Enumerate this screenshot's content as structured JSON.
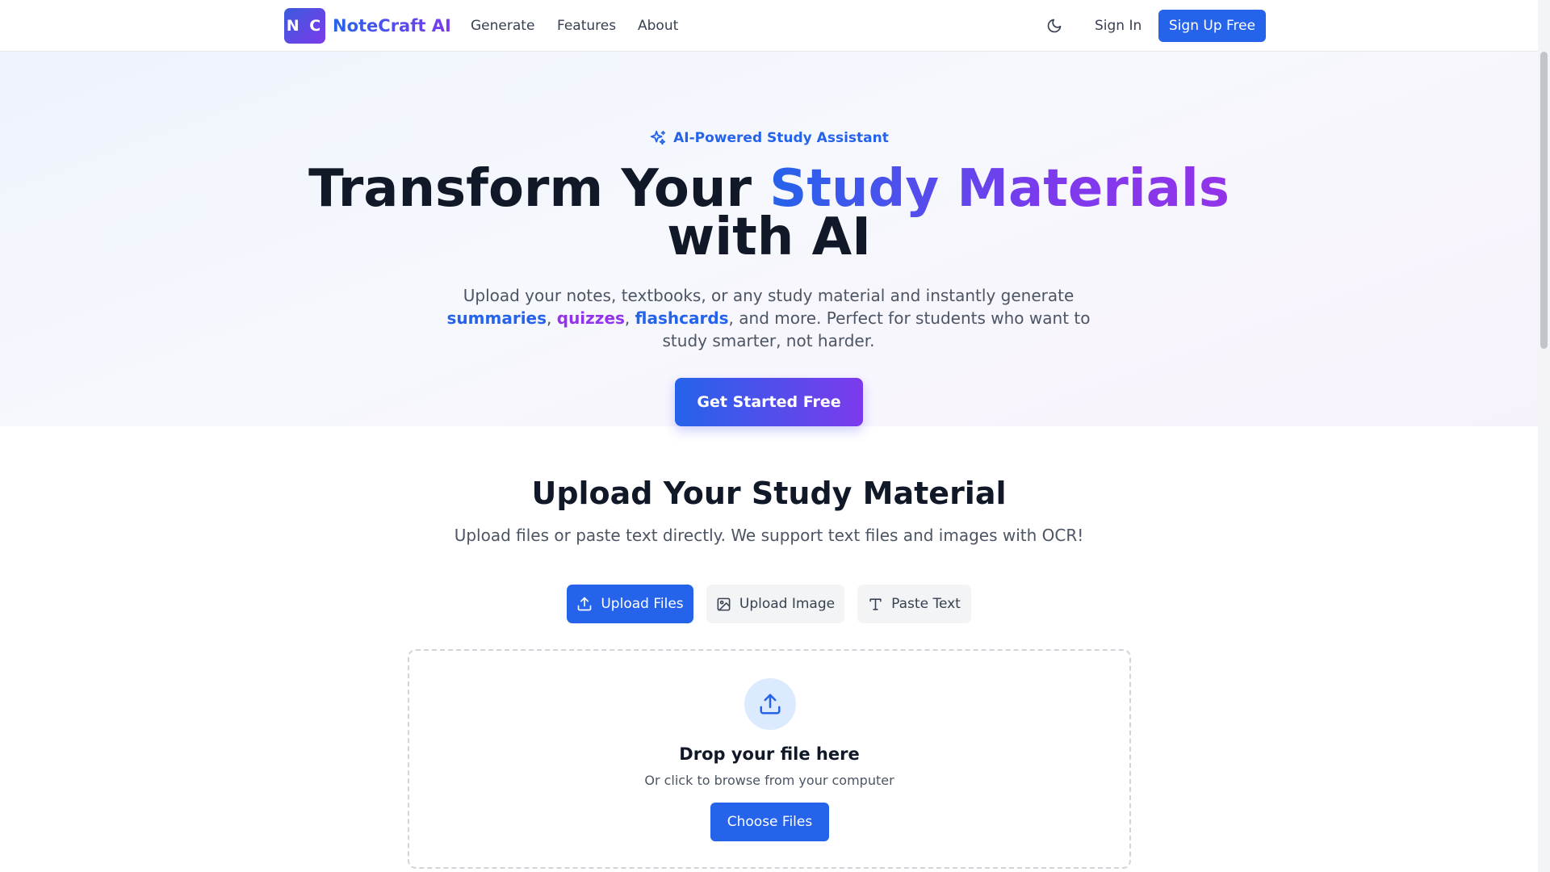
{
  "header": {
    "logo_initials": "N C",
    "brand": "NoteCraft AI",
    "nav": [
      "Generate",
      "Features",
      "About"
    ],
    "theme_icon": "moon-icon",
    "signin_label": "Sign In",
    "signup_label": "Sign Up Free"
  },
  "hero": {
    "badge_icon": "sparkles-icon",
    "badge": "AI-Powered Study Assistant",
    "title_part1": "Transform Your ",
    "title_highlight": "Study Materials",
    "title_part2": "with AI",
    "subtitle_part1": "Upload your notes, textbooks, or any study material and instantly generate ",
    "subtitle_summaries": "summaries",
    "subtitle_sep1": ", ",
    "subtitle_quizzes": "quizzes",
    "subtitle_sep2": ", ",
    "subtitle_flashcards": "flashcards",
    "subtitle_part2": ", and more. Perfect for students who want to study smarter, not harder.",
    "cta_label": "Get Started Free"
  },
  "upload": {
    "title": "Upload Your Study Material",
    "subtitle": "Upload files or paste text directly. We support text files and images with OCR!",
    "tabs": [
      {
        "label": "Upload Files",
        "icon": "upload-icon",
        "active": true
      },
      {
        "label": "Upload Image",
        "icon": "image-icon",
        "active": false
      },
      {
        "label": "Paste Text",
        "icon": "text-icon",
        "active": false
      }
    ],
    "dropzone": {
      "icon": "upload-icon",
      "title": "Drop your file here",
      "subtitle": "Or click to browse from your computer",
      "button_label": "Choose Files"
    }
  },
  "colors": {
    "primary": "#2563eb",
    "accent_purple": "#7c3aed",
    "purple_text": "#9333ea",
    "heading": "#111827",
    "body_text": "#4b5563"
  }
}
